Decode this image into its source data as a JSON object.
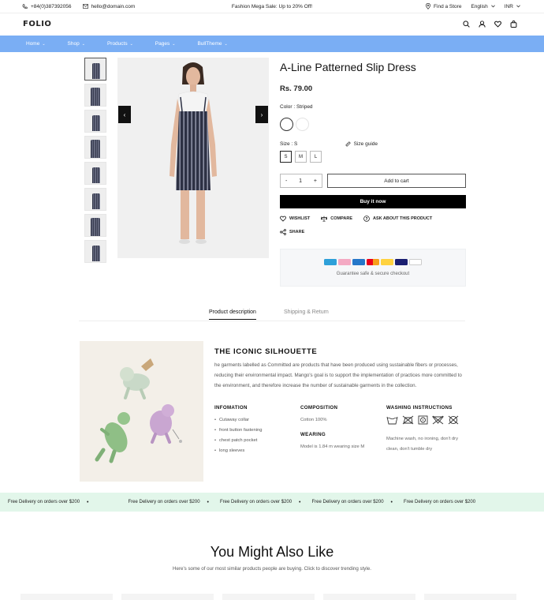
{
  "topbar": {
    "phone": "+84(0)387392056",
    "email": "hello@domain.com",
    "promo": "Fashion Mega Sale: Up to 20% Off!",
    "find_store": "Find a Store",
    "language": "English",
    "currency": "INR"
  },
  "header": {
    "logo": "FOLIO"
  },
  "nav": {
    "items": [
      {
        "label": "Home"
      },
      {
        "label": "Shop"
      },
      {
        "label": "Products"
      },
      {
        "label": "Pages"
      },
      {
        "label": "BullTheme"
      }
    ]
  },
  "product": {
    "title": "A-Line Patterned Slip Dress",
    "price": "Rs. 79.00",
    "color_label": "Color : Striped",
    "size_label": "Size : S",
    "size_guide": "Size guide",
    "sizes": [
      "S",
      "M",
      "L"
    ],
    "quantity": "1",
    "qty_minus": "-",
    "qty_plus": "+",
    "add_to_cart": "Add to cart",
    "buy_now": "Buy it now",
    "wishlist": "WISHLIST",
    "compare": "COMPARE",
    "ask": "ASK ABOUT THIS PRODUCT",
    "share": "SHARE",
    "guarantee": "Guarantee safe & secure checkout",
    "payments": [
      "Amazon",
      "Klarna",
      "Amex",
      "Mastercard",
      "Visa",
      "PayPal"
    ]
  },
  "tabs": {
    "description": "Product description",
    "shipping": "Shipping & Return"
  },
  "description": {
    "heading": "THE ICONIC SILHOUETTE",
    "body": "he garments labelled as Committed are products that have been produced using sustainable fibers or processes, reducing their environmental impact. Mango's goal is to support the implementation of practices more committed to the environment, and therefore increase the number of sustainable garments in the collection.",
    "info_heading": "INFOMATION",
    "info_items": [
      "Cutaway collar",
      "front button fastening",
      "chest patch pocket",
      "long sleeves"
    ],
    "composition_heading": "COMPOSITION",
    "composition": "Cotton 100%",
    "wearing_heading": "WEARING",
    "wearing": "Model is 1.84 m wearing size M",
    "washing_heading": "WASHING INSTRUCTIONS",
    "washing": "Machine wash, no ironing, don't dry clean, don't tumble dry"
  },
  "marquee": {
    "text": "Free Delivery on orders over $200"
  },
  "related": {
    "title": "You Might Also Like",
    "subtitle": "Here's some of our most similar products people are buying. Click to discover trending style."
  },
  "colors": {
    "nav": "#7aaef4",
    "marquee": "#e2f6ea",
    "dress": "#2d3144"
  },
  "icons": [
    "phone-icon",
    "mail-icon",
    "location-icon",
    "search-icon",
    "user-icon",
    "heart-icon",
    "bag-icon",
    "ruler-icon",
    "compare-icon",
    "question-icon",
    "share-icon"
  ]
}
